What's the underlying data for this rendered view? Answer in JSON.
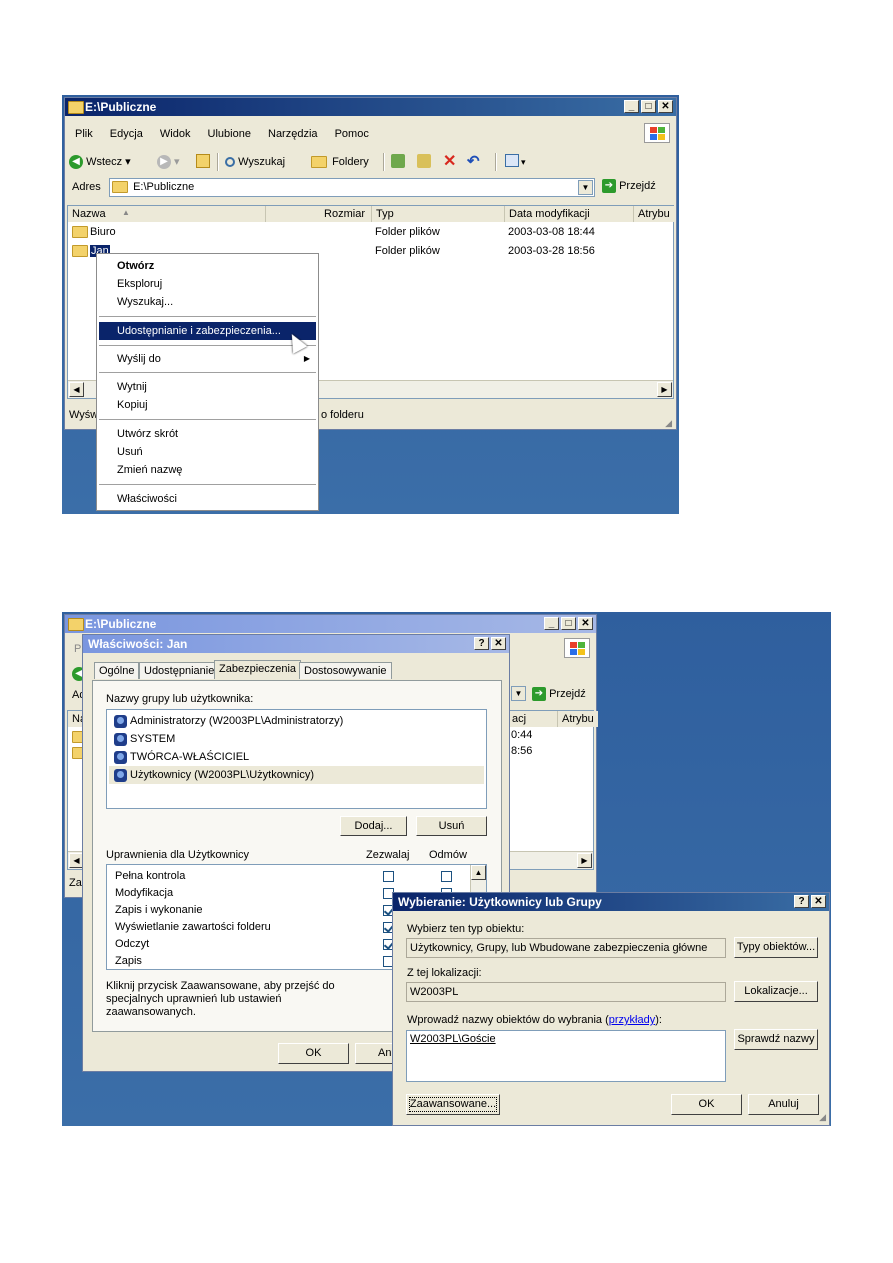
{
  "explorer": {
    "title": "E:\\Publiczne",
    "menu": [
      "Plik",
      "Edycja",
      "Widok",
      "Ulubione",
      "Narzędzia",
      "Pomoc"
    ],
    "toolbar": {
      "back": "Wstecz",
      "search": "Wyszukaj",
      "folders": "Foldery"
    },
    "address_label": "Adres",
    "address_value": "E:\\Publiczne",
    "go_label": "Przejdź",
    "columns": [
      "Nazwa",
      "Rozmiar",
      "Typ",
      "Data modyfikacji",
      "Atrybu"
    ],
    "rows": [
      {
        "name": "Biuro",
        "type": "Folder plików",
        "date": "2003-03-08 18:44"
      },
      {
        "name": "Jan",
        "type": "Folder plików",
        "date": "2003-03-28 18:56"
      }
    ],
    "status_left": "Wyśw",
    "status_right": "o folderu"
  },
  "context_menu": {
    "items": [
      {
        "label": "Otwórz",
        "bold": true
      },
      {
        "label": "Eksploruj"
      },
      {
        "label": "Wyszukaj..."
      },
      {
        "label": "Udostępnianie i zabezpieczenia...",
        "selected": true
      },
      {
        "label": "Wyślij do",
        "submenu": true
      },
      {
        "label": "Wytnij"
      },
      {
        "label": "Kopiuj"
      },
      {
        "label": "Utwórz skrót"
      },
      {
        "label": "Usuń"
      },
      {
        "label": "Zmień nazwę"
      },
      {
        "label": "Właściwości"
      }
    ]
  },
  "explorer2": {
    "title": "E:\\Publiczne",
    "go_label": "Przejdź",
    "col_partial": "acj",
    "col_attr": "Atrybu",
    "time1": "0:44",
    "time2": "8:56",
    "left_stub_1": "P",
    "left_stub_2": "Ad",
    "left_stub_3": "Na",
    "left_stub_4": "Zaz",
    "pomoc_stub": "c"
  },
  "properties": {
    "title": "Właściwości: Jan",
    "tabs": [
      "Ogólne",
      "Udostępnianie",
      "Zabezpieczenia",
      "Dostosowywanie"
    ],
    "groups_label": "Nazwy grupy lub użytkownika:",
    "groups": [
      "Administratorzy (W2003PL\\Administratorzy)",
      "SYSTEM",
      "TWÓRCA-WŁAŚCICIEL",
      "Użytkownicy (W2003PL\\Użytkownicy)"
    ],
    "add_button": "Dodaj...",
    "remove_button": "Usuń",
    "perm_label": "Uprawnienia dla Użytkownicy",
    "allow_label": "Zezwalaj",
    "deny_label": "Odmów",
    "permissions": [
      {
        "name": "Pełna kontrola",
        "allow": false,
        "deny": false
      },
      {
        "name": "Modyfikacja",
        "allow": false,
        "deny": false
      },
      {
        "name": "Zapis i wykonanie",
        "allow": true,
        "deny": false
      },
      {
        "name": "Wyświetlanie zawartości folderu",
        "allow": true,
        "deny": false
      },
      {
        "name": "Odczyt",
        "allow": true,
        "deny": false
      },
      {
        "name": "Zapis",
        "allow": false,
        "deny": false
      }
    ],
    "advanced_note": "Kliknij przycisk Zaawansowane, aby przejść do specjalnych uprawnień lub ustawień zaawansowanych.",
    "ok_button": "OK",
    "cancel_stub": "Anu"
  },
  "select_dialog": {
    "title": "Wybieranie: Użytkownicy lub Grupy",
    "type_label": "Wybierz ten typ obiektu:",
    "type_value": "Użytkownicy, Grupy, lub Wbudowane zabezpieczenia główne",
    "types_button": "Typy obiektów...",
    "location_label": "Z tej lokalizacji:",
    "location_value": "W2003PL",
    "locations_button": "Lokalizacje...",
    "names_label": "Wprowadź nazwy obiektów do wybrania (",
    "examples_link": "przykłady",
    "names_label_end": "):",
    "names_value": "W2003PL\\Goście",
    "check_button": "Sprawdź nazwy",
    "advanced_button": "Zaawansowane...",
    "ok_button": "OK",
    "cancel_button": "Anuluj"
  },
  "colors": {
    "desktop": "#3a6ea5",
    "title_active": "#0a246a",
    "dialog_bg": "#ece9d8"
  }
}
